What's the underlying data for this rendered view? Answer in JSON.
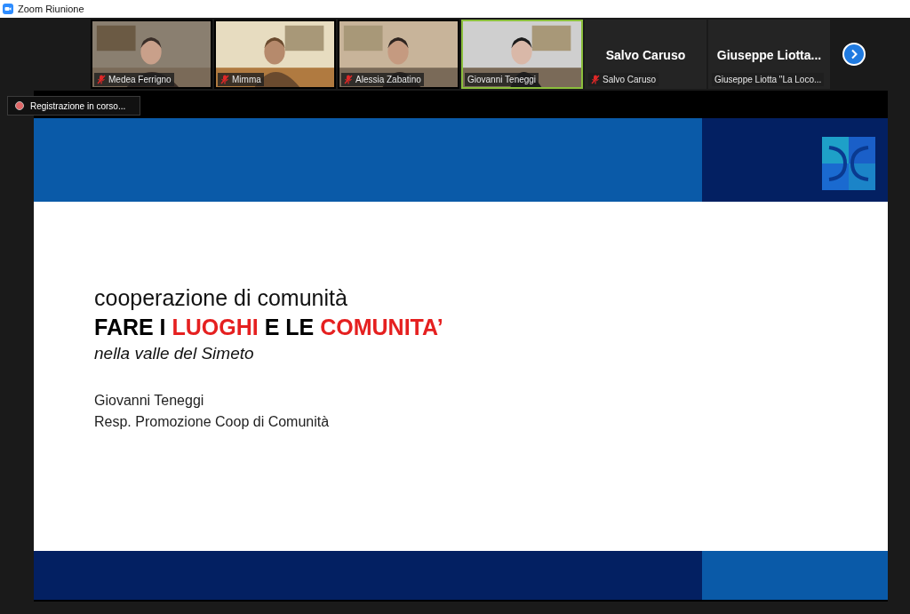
{
  "window": {
    "title": "Zoom Riunione"
  },
  "participants": [
    {
      "kind": "video",
      "name": "Medea Ferrigno",
      "muted": true,
      "speaking": false
    },
    {
      "kind": "video",
      "name": "Mimma",
      "muted": true,
      "speaking": false
    },
    {
      "kind": "video",
      "name": "Alessia Zabatino",
      "muted": true,
      "speaking": false
    },
    {
      "kind": "video",
      "name": "Giovanni Teneggi",
      "muted": false,
      "speaking": true
    },
    {
      "kind": "name",
      "display": "Salvo Caruso",
      "name": "Salvo Caruso",
      "muted": true,
      "speaking": false
    },
    {
      "kind": "name",
      "display": "Giuseppe  Liotta...",
      "name": "Giuseppe Liotta \"La Loco...",
      "muted": false,
      "speaking": false
    }
  ],
  "recording": {
    "label": "Registrazione in corso..."
  },
  "slide": {
    "subtitle": "cooperazione di comunità",
    "title": [
      {
        "text": "FARE I ",
        "emphasis": false
      },
      {
        "text": "LUOGHI",
        "emphasis": true
      },
      {
        "text": " E LE ",
        "emphasis": false
      },
      {
        "text": "COMUNITA’",
        "emphasis": true
      }
    ],
    "place": "nella valle del Simeto",
    "speaker": "Giovanni Teneggi",
    "role": "Resp. Promozione Coop di Comunità"
  }
}
